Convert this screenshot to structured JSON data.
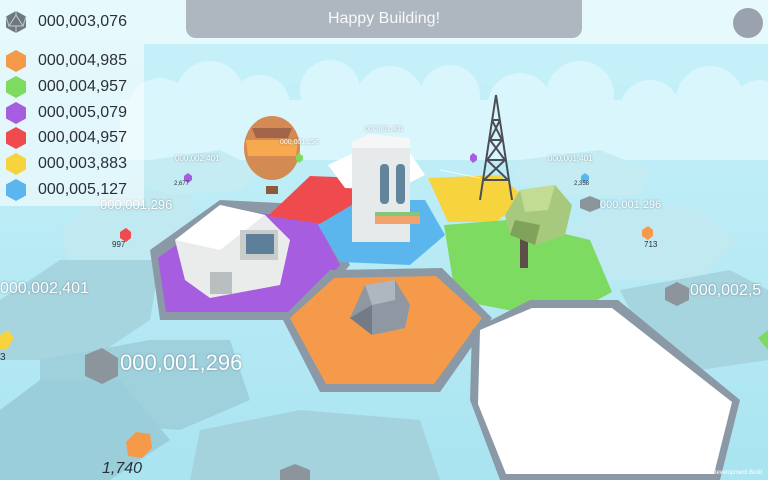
{
  "hud": {
    "total_score": "000,003,076",
    "total_icon": "d20-icon",
    "banner_text": "Happy Building!",
    "menu_icon": "circle-menu-icon"
  },
  "resources": [
    {
      "name": "orange",
      "color": "#f59a4b",
      "value": "000,004,985"
    },
    {
      "name": "green",
      "color": "#7ddb61",
      "value": "000,004,957"
    },
    {
      "name": "purple",
      "color": "#a65de0",
      "value": "000,005,079"
    },
    {
      "name": "red",
      "color": "#ef4b4f",
      "value": "000,004,957"
    },
    {
      "name": "yellow",
      "color": "#f7d43d",
      "value": "000,003,883"
    },
    {
      "name": "blue",
      "color": "#5bb6ee",
      "value": "000,005,127"
    }
  ],
  "world_labels": [
    {
      "text": "000,001,296",
      "kind": "score"
    },
    {
      "text": "000,002,401",
      "kind": "score"
    },
    {
      "text": "000,001,296",
      "kind": "score"
    },
    {
      "text": "000,002,5",
      "kind": "score"
    },
    {
      "text": "000,001,296",
      "kind": "score"
    },
    {
      "text": "000,002,401",
      "kind": "score"
    },
    {
      "text": "000,001,296",
      "kind": "score"
    },
    {
      "text": "000,001,401",
      "kind": "score"
    },
    {
      "text": "000,001,401",
      "kind": "score"
    },
    {
      "text": "997",
      "kind": "count"
    },
    {
      "text": "713",
      "kind": "count"
    },
    {
      "text": "1,740",
      "kind": "count"
    },
    {
      "text": "2,677",
      "kind": "count"
    },
    {
      "text": "2,358",
      "kind": "count"
    },
    {
      "text": "3",
      "kind": "count"
    }
  ],
  "footer": {
    "dev_build": "Development Build"
  }
}
